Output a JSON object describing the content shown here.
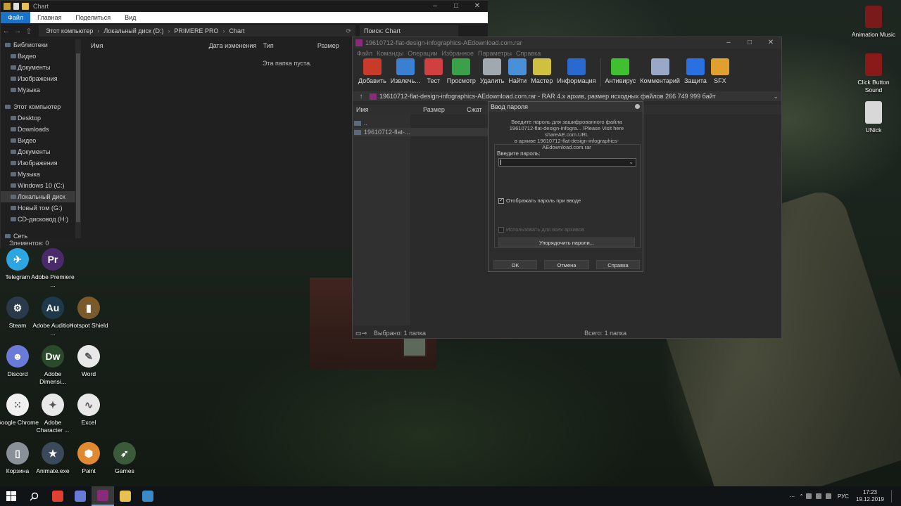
{
  "explorer": {
    "title": "Chart",
    "ribbon_tabs": [
      "Файл",
      "Главная",
      "Поделиться",
      "Вид"
    ],
    "breadcrumb": [
      "Этот компьютер",
      "Локальный диск (D:)",
      "PRIMERE PRO",
      "Chart"
    ],
    "search_placeholder": "Поиск: Chart",
    "sidebar": [
      {
        "label": "Библиотеки",
        "hdr": true
      },
      {
        "label": "Видео"
      },
      {
        "label": "Документы"
      },
      {
        "label": "Изображения"
      },
      {
        "label": "Музыка"
      },
      {
        "label": "",
        "spacer": true
      },
      {
        "label": "Этот компьютер",
        "hdr": true
      },
      {
        "label": "Desktop"
      },
      {
        "label": "Downloads"
      },
      {
        "label": "Видео"
      },
      {
        "label": "Документы"
      },
      {
        "label": "Изображения"
      },
      {
        "label": "Музыка"
      },
      {
        "label": "Windows 10 (C:)"
      },
      {
        "label": "Локальный диск",
        "selected": true
      },
      {
        "label": "Новый том (G:)"
      },
      {
        "label": "CD-дисковод (H:)"
      },
      {
        "label": "",
        "spacer": true
      },
      {
        "label": "Сеть",
        "hdr": true
      }
    ],
    "columns": [
      "Имя",
      "Дата изменения",
      "Тип",
      "Размер"
    ],
    "empty_text": "Эта папка пуста.",
    "status": "Элементов: 0"
  },
  "winrar": {
    "title": "19610712-flat-design-infographics-AEdownload.com.rar",
    "menu": [
      "Файл",
      "Команды",
      "Операции",
      "Избранное",
      "Параметры",
      "Справка"
    ],
    "toolbar": [
      {
        "label": "Добавить",
        "icon": "add-icon",
        "color": "#c83a2a"
      },
      {
        "label": "Извлечь...",
        "icon": "extract-icon",
        "color": "#3a7fd0"
      },
      {
        "label": "Тест",
        "icon": "test-icon",
        "color": "#d04040"
      },
      {
        "label": "Просмотр",
        "icon": "view-icon",
        "color": "#3aa04a"
      },
      {
        "label": "Удалить",
        "icon": "delete-icon",
        "color": "#a0a8b0"
      },
      {
        "label": "Найти",
        "icon": "find-icon",
        "color": "#4a90d8"
      },
      {
        "label": "Мастер",
        "icon": "wizard-icon",
        "color": "#d0c040"
      },
      {
        "label": "Информация",
        "icon": "info-icon",
        "color": "#2a6ad0"
      },
      {
        "label": "Антивирус",
        "icon": "antivirus-icon",
        "color": "#40c030"
      },
      {
        "label": "Комментарий",
        "icon": "comment-icon",
        "color": "#9aa8c8"
      },
      {
        "label": "Защита",
        "icon": "protect-icon",
        "color": "#2a70e0"
      },
      {
        "label": "SFX",
        "icon": "sfx-icon",
        "color": "#e0a030"
      }
    ],
    "path_text": "19610712-flat-design-infographics-AEdownload.com.rar - RAR 4.x архив, размер исходных файлов 266 749 999 байт",
    "columns": [
      "Имя",
      "Размер",
      "Сжат"
    ],
    "rows": [
      "..",
      "19610712-flat-..."
    ],
    "status_left": "Выбрано: 1 папка",
    "status_right": "Всего: 1 папка"
  },
  "dialog": {
    "title": "Ввод пароля",
    "message_line1": "Введите пароль для зашифрованного файла",
    "message_line2": "19610712-flat-design-infogra... \\Please Visit here shareAE.com.URL",
    "message_line3": "в архиве 19610712-flat-design-infographics-AEdownload.com.rar",
    "field_label": "Введите пароль:",
    "password_value": "",
    "show_password_label": "Отображать пароль при вводе",
    "show_password_checked": true,
    "use_all_label": "Использовать для всех архивов",
    "organize_button": "Упорядочить пароли...",
    "ok": "OK",
    "cancel": "Отмена",
    "help": "Справка"
  },
  "desktop_icons": [
    {
      "label": "Telegram",
      "icon": "telegram-icon",
      "color": "#2ca5e0",
      "glyph": "✈"
    },
    {
      "label": "Adobe Premiere ...",
      "icon": "premiere-icon",
      "color": "#4a2a6a",
      "glyph": "Pr"
    },
    {
      "label": "Steam",
      "icon": "steam-icon",
      "color": "#2a3a4a",
      "glyph": "⚙"
    },
    {
      "label": "Adobe Audition ...",
      "icon": "audition-icon",
      "color": "#1e3a4a",
      "glyph": "Au"
    },
    {
      "label": "Hotspot Shield",
      "icon": "hotspot-icon",
      "color": "#7a5a2a",
      "glyph": "▮"
    },
    {
      "label": "Discord",
      "icon": "discord-icon",
      "color": "#6a7ad8",
      "glyph": "☻"
    },
    {
      "label": "Adobe Dimensi...",
      "icon": "dreamweaver-icon",
      "color": "#2a4a2a",
      "glyph": "Dw"
    },
    {
      "label": "Word",
      "icon": "word-icon",
      "color": "#e8e8e8",
      "glyph": "✎"
    },
    {
      "label": "Google Chrome",
      "icon": "chrome-icon",
      "color": "#f0f0f0",
      "glyph": "⁙"
    },
    {
      "label": "Adobe Character ...",
      "icon": "character-icon",
      "color": "#e8e8e8",
      "glyph": "✦"
    },
    {
      "label": "Excel",
      "icon": "excel-icon",
      "color": "#e8e8e8",
      "glyph": "∿"
    },
    {
      "label": "Корзина",
      "icon": "recycle-bin-icon",
      "color": "#8a9098",
      "glyph": "▯"
    },
    {
      "label": "Animate.exe",
      "icon": "animate-icon",
      "color": "#3a4a5a",
      "glyph": "★"
    },
    {
      "label": "Paint",
      "icon": "paint-icon",
      "color": "#e08a30",
      "glyph": "⬢"
    },
    {
      "label": "Games",
      "icon": "games-icon",
      "color": "#3a5a3a",
      "glyph": "➶"
    }
  ],
  "right_icons": [
    {
      "label": "Animation Music",
      "icon": "animation-music-icon",
      "color": "#7a1a1a"
    },
    {
      "label": "Click Button Sound",
      "icon": "click-sound-icon",
      "color": "#8a1a1a"
    },
    {
      "label": "UNick",
      "icon": "unick-icon",
      "color": "#d8d8d8"
    }
  ],
  "taskbar": {
    "apps": [
      {
        "icon": "chrome-taskbar-icon",
        "color": "#e04030"
      },
      {
        "icon": "discord-taskbar-icon",
        "color": "#6a7ad8"
      },
      {
        "icon": "winrar-taskbar-icon",
        "color": "#8a2a7a",
        "active": true
      },
      {
        "icon": "explorer-taskbar-icon",
        "color": "#e8c050"
      },
      {
        "icon": "app-taskbar-icon",
        "color": "#3a8ac8"
      }
    ],
    "lang": "РУС",
    "time": "17:23",
    "date": "19.12.2019"
  }
}
